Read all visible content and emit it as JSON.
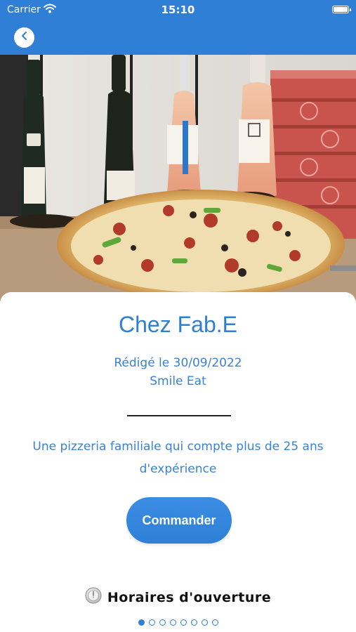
{
  "status_bar": {
    "carrier": "Carrier",
    "time": "15:10",
    "battery_icon": "battery-full-icon",
    "wifi_icon": "wifi-icon"
  },
  "nav": {
    "back_icon": "chevron-left-icon",
    "background_color": "#2f7fd6"
  },
  "hero_image": {
    "subject": "pizza-with-wine-bottles-photo"
  },
  "restaurant": {
    "name": "Chez Fab.E",
    "written_on": "Rédigé le 30/09/2022",
    "author": "Smile Eat",
    "description": "Une pizzeria familiale qui compte plus de 25 ans d'expérience"
  },
  "actions": {
    "order_label": "Commander"
  },
  "hours": {
    "icon": "clock-icon",
    "label": "Horaires d'ouverture"
  },
  "pager": {
    "count": 8,
    "active": 0
  },
  "colors": {
    "accent": "#2f7fd6",
    "text_accent": "#3a83cf"
  }
}
